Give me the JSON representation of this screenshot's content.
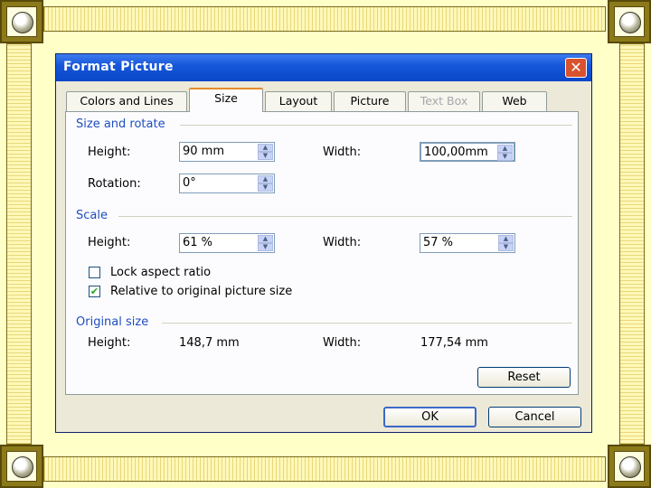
{
  "window": {
    "title": "Format Picture",
    "close_label": "✕"
  },
  "tabs": [
    {
      "label": "Colors and Lines"
    },
    {
      "label": "Size"
    },
    {
      "label": "Layout"
    },
    {
      "label": "Picture"
    },
    {
      "label": "Text Box"
    },
    {
      "label": "Web"
    }
  ],
  "size_rotate": {
    "heading": "Size and rotate",
    "height_label": "Height:",
    "height_value": "90 mm",
    "width_label": "Width:",
    "width_value": "100,00mm",
    "rotation_label": "Rotation:",
    "rotation_value": "0°"
  },
  "scale": {
    "heading": "Scale",
    "height_label": "Height:",
    "height_value": "61 %",
    "width_label": "Width:",
    "width_value": "57 %",
    "lock_aspect_label": "Lock aspect ratio",
    "lock_aspect_checked": false,
    "relative_label": "Relative to original picture size",
    "relative_checked": true
  },
  "original": {
    "heading": "Original size",
    "height_label": "Height:",
    "height_value": "148,7 mm",
    "width_label": "Width:",
    "width_value": "177,54 mm"
  },
  "buttons": {
    "reset": "Reset",
    "ok": "OK",
    "cancel": "Cancel"
  },
  "glyphs": {
    "check": "✔",
    "up": "▲",
    "down": "▼"
  }
}
